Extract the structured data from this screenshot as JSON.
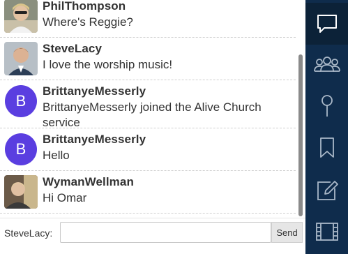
{
  "messages": [
    {
      "author": "PhilThompson",
      "text": "Where's Reggie?",
      "avatar": "photo"
    },
    {
      "author": "SteveLacy",
      "text": "I love the worship music!",
      "avatar": "photo"
    },
    {
      "author": "BrittanyeMesserly",
      "text": "BrittanyeMesserly joined the Alive Church service",
      "avatar": "B"
    },
    {
      "author": "BrittanyeMesserly",
      "text": "Hello",
      "avatar": "B"
    },
    {
      "author": "WymanWellman",
      "text": "Hi Omar",
      "avatar": "photo"
    }
  ],
  "composer": {
    "user_label": "SteveLacy:",
    "input_value": "",
    "send_label": "Send"
  },
  "sidebar": {
    "items": [
      {
        "icon": "chat-icon",
        "active": true
      },
      {
        "icon": "people-icon",
        "active": false
      },
      {
        "icon": "pin-icon",
        "active": false
      },
      {
        "icon": "bookmark-icon",
        "active": false
      },
      {
        "icon": "edit-note-icon",
        "active": false
      },
      {
        "icon": "film-icon",
        "active": false
      }
    ]
  },
  "colors": {
    "sidebar_bg": "#0f2c4c",
    "avatar_letter_bg": "#5a3ee0",
    "text": "#333333"
  }
}
